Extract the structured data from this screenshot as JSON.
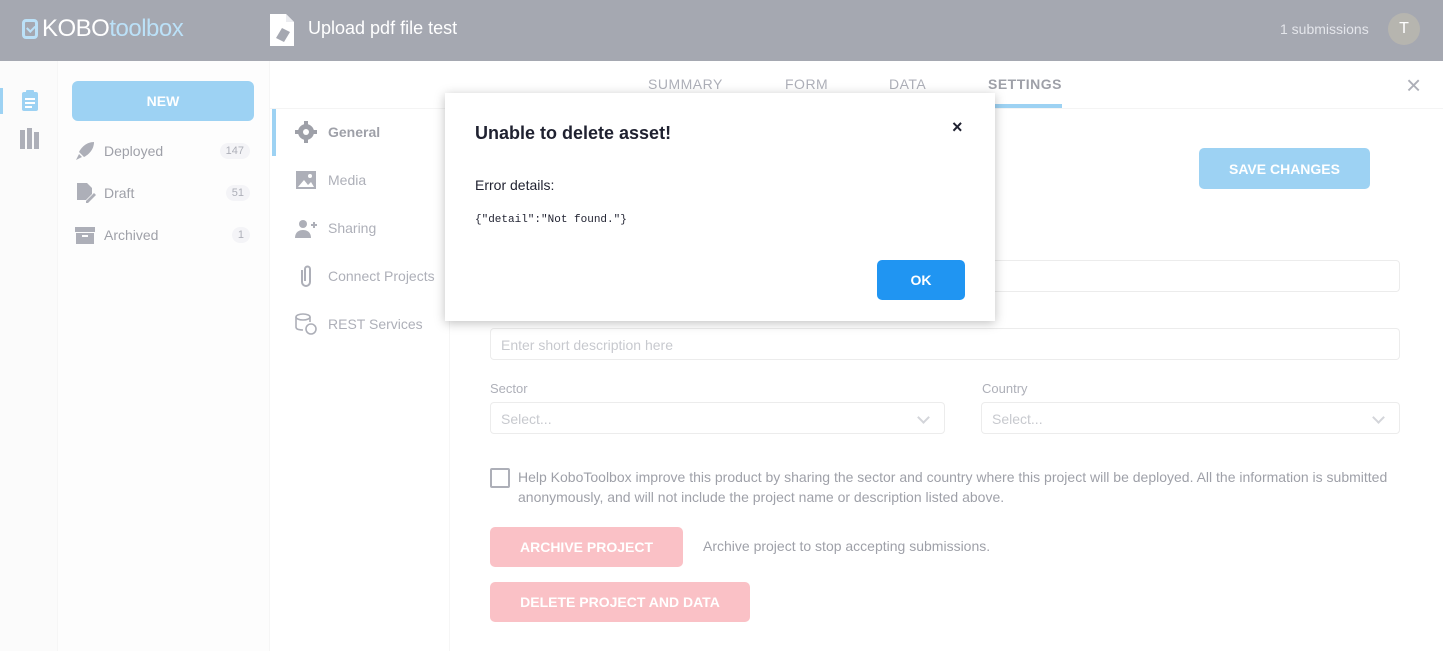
{
  "header": {
    "logo_left": "KOBO",
    "logo_right": "toolbox",
    "asset_title": "Upload pdf file test",
    "submissions": "1 submissions",
    "avatar_initial": "T"
  },
  "sidebar": {
    "new_label": "NEW",
    "items": [
      {
        "label": "Deployed",
        "count": "147"
      },
      {
        "label": "Draft",
        "count": "51"
      },
      {
        "label": "Archived",
        "count": "1"
      }
    ]
  },
  "tabs": [
    {
      "label": "SUMMARY"
    },
    {
      "label": "FORM"
    },
    {
      "label": "DATA"
    },
    {
      "label": "SETTINGS"
    }
  ],
  "close_symbol": "×",
  "settings_nav": [
    {
      "label": "General"
    },
    {
      "label": "Media"
    },
    {
      "label": "Sharing"
    },
    {
      "label": "Connect Projects"
    },
    {
      "label": "REST Services"
    }
  ],
  "form": {
    "save_label": "SAVE CHANGES",
    "description_placeholder": "Enter short description here",
    "sector_label": "Sector",
    "sector_placeholder": "Select...",
    "country_label": "Country",
    "country_placeholder": "Select...",
    "consent_text": "Help KoboToolbox improve this product by sharing the sector and country where this project will be deployed. All the information is submitted anonymously, and will not include the project name or description listed above.",
    "archive_label": "ARCHIVE PROJECT",
    "archive_desc": "Archive project to stop accepting submissions.",
    "delete_label": "DELETE PROJECT AND DATA"
  },
  "modal": {
    "title": "Unable to delete asset!",
    "close_symbol": "×",
    "label": "Error details:",
    "code": "{\"detail\":\"Not found.\"}",
    "ok_label": "OK"
  },
  "colors": {
    "accent": "#3aa4e6",
    "danger": "#f4828c",
    "header_bg": "#4b5063",
    "ok_button": "#2095f2"
  }
}
